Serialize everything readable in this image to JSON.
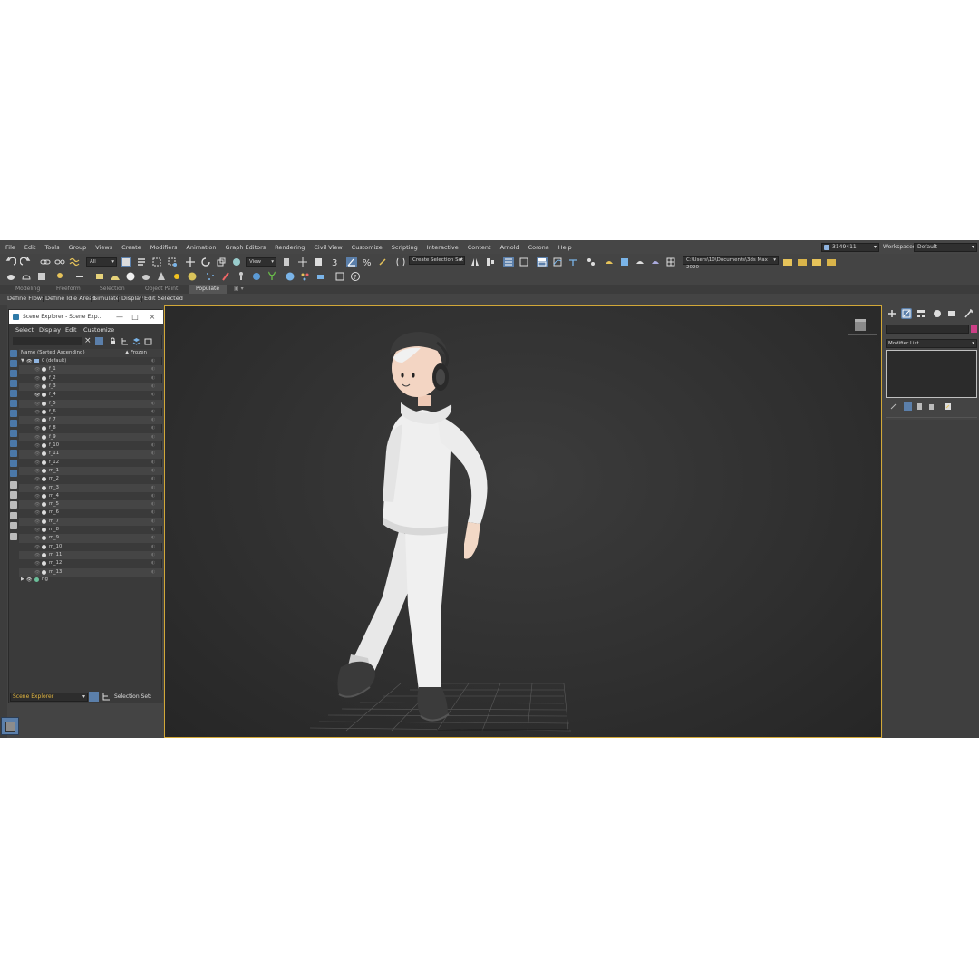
{
  "menu": [
    "File",
    "Edit",
    "Tools",
    "Group",
    "Views",
    "Create",
    "Modifiers",
    "Animation",
    "Graph Editors",
    "Rendering",
    "Civil View",
    "Customize",
    "Scripting",
    "Interactive",
    "Content",
    "Arnold",
    "Corona",
    "Help"
  ],
  "user": {
    "name": "3149411"
  },
  "workspace": {
    "label": "Workspaces:",
    "value": "Default"
  },
  "toolbar": {
    "filter_value": "All",
    "refcoord_value": "View",
    "selection_set_placeholder": "Create Selection Set",
    "project_path": "C:\\Users\\10\\Documents\\3ds Max 2020"
  },
  "ribbon": {
    "tabs": [
      "Modeling",
      "Freeform",
      "Selection",
      "Object Paint",
      "Populate"
    ],
    "active_tab": "Populate",
    "subtabs": [
      "Define Flows",
      "Define Idle Areas",
      "Simulate",
      "Display",
      "Edit Selected"
    ]
  },
  "scene_explorer": {
    "title": "Scene Explorer - Scene Exp...",
    "menu": [
      "Select",
      "Display",
      "Edit",
      "Customize"
    ],
    "col_name": "Name (Sorted Ascending)",
    "col_frozen": "▲ Frozen",
    "root": "0 (default)",
    "items": [
      "f_1",
      "f_2",
      "f_3",
      "f_4",
      "f_5",
      "f_6",
      "f_7",
      "f_8",
      "f_9",
      "f_10",
      "f_11",
      "f_12",
      "m_1",
      "m_2",
      "m_3",
      "m_4",
      "m_5",
      "m_6",
      "m_7",
      "m_8",
      "m_9",
      "m_10",
      "m_11",
      "m_12",
      "m_13"
    ],
    "visible_item": "f_4",
    "rig": "rig",
    "bottom_dropdown": "Scene Explorer",
    "selection_set_label": "Selection Set:"
  },
  "command_panel": {
    "modifier_list": "Modifier List",
    "object_color": "#cc3f86"
  },
  "colors": {
    "accent": "#5b7faa",
    "viewport_border": "#d2a838",
    "viewport_bg": "#333333",
    "highlight_text": "#e2b640"
  }
}
